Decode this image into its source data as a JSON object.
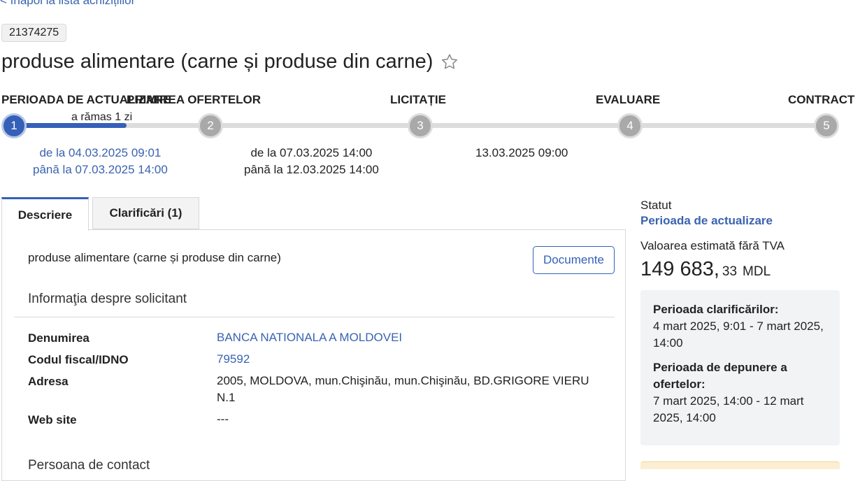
{
  "nav": {
    "back_label": "< înapoi la lista achizițiilor"
  },
  "tender": {
    "id": "21374275",
    "title": "produse alimentare (carne și produse din carne)"
  },
  "stepper": {
    "stages": [
      {
        "number": "1",
        "label": "PERIOADA DE ACTUALIZARE",
        "active": true
      },
      {
        "number": "2",
        "label": "PRIMIREA OFERTELOR",
        "active": false
      },
      {
        "number": "3",
        "label": "LICITAȚIE",
        "active": false
      },
      {
        "number": "4",
        "label": "EVALUARE",
        "active": false
      },
      {
        "number": "5",
        "label": "CONTRACT",
        "active": false
      }
    ],
    "remaining": "a rămas 1 zi",
    "progress_fraction": 0.14,
    "dates": {
      "stage1_from": "de la 04.03.2025 09:01",
      "stage1_to": "până la 07.03.2025 14:00",
      "stage2_from": "de la 07.03.2025 14:00",
      "stage2_to": "până la 12.03.2025 14:00",
      "stage3": "13.03.2025 09:00"
    }
  },
  "tabs": [
    {
      "label": "Descriere",
      "active": true
    },
    {
      "label": "Clarificări (1)",
      "active": false
    }
  ],
  "description": {
    "text": "produse alimentare (carne și produse din carne)",
    "documents_button": "Documente",
    "applicant_heading": "Informaţia despre solicitant",
    "fields": [
      {
        "label": "Denumirea",
        "value": "BANCA NATIONALA A MOLDOVEI",
        "link": true
      },
      {
        "label": "Codul fiscal/IDNO",
        "value": "79592",
        "link": true
      },
      {
        "label": "Adresa",
        "value": "2005, MOLDOVA, mun.Chişinău, mun.Chişinău, BD.GRIGORE VIERU N.1",
        "link": false
      },
      {
        "label": "Web site",
        "value": "---",
        "link": false
      }
    ],
    "contact_heading": "Persoana de contact"
  },
  "sidebar": {
    "status_label": "Statut",
    "status_value": "Perioada de actualizare",
    "value_label": "Valoarea estimată fără TVA",
    "value_int": "149 683,",
    "value_dec": "33",
    "currency": "MDL",
    "periods": {
      "clarif_title": "Perioada clarificărilor:",
      "clarif_text": "4 mart 2025, 9:01 - 7 mart 2025, 14:00",
      "offers_title": "Perioada de depunere a ofertelor:",
      "offers_text": "7 mart 2025, 14:00 - 12 mart 2025, 14:00"
    }
  },
  "colors": {
    "accent": "#3460b8",
    "link": "#3a63b0",
    "inactive_step": "#a9a9a9",
    "track": "#dcdcdc"
  },
  "icons": {
    "favorite": "star-outline-icon"
  }
}
